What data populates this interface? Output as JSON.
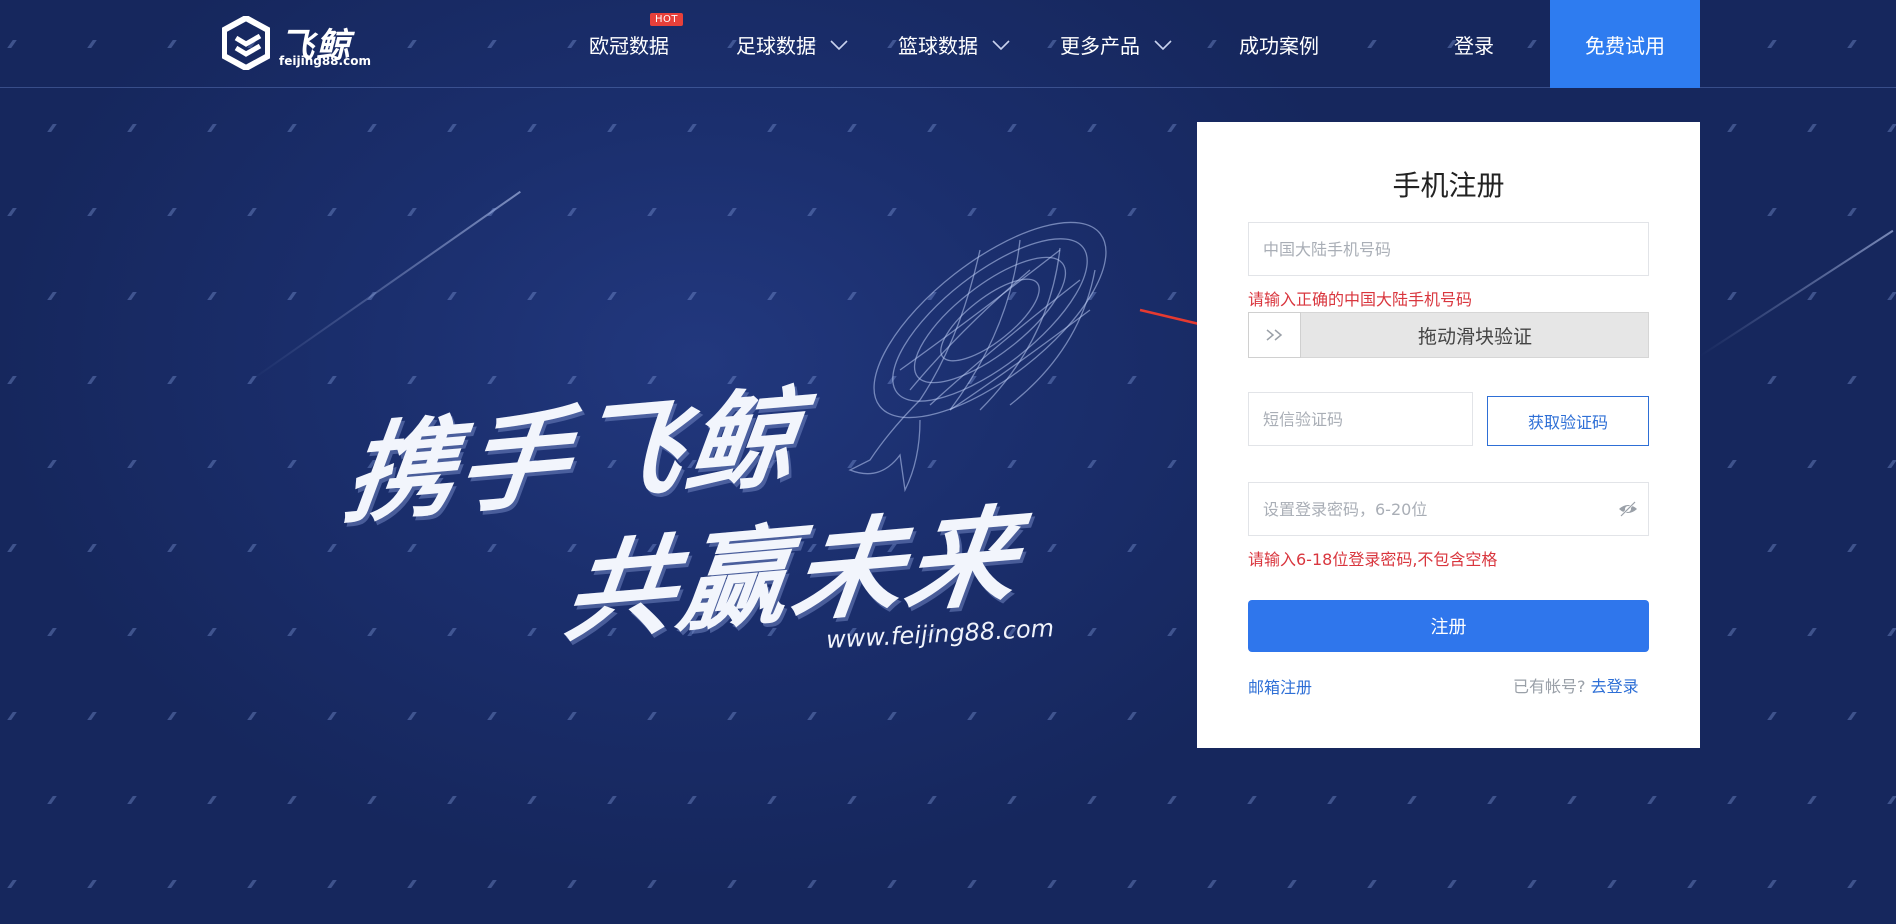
{
  "brand": {
    "name_cn": "飞鲸",
    "domain": "feijing88.com"
  },
  "nav": {
    "items": [
      {
        "label": "欧冠数据",
        "badge": "HOT",
        "dropdown": false
      },
      {
        "label": "足球数据",
        "dropdown": true
      },
      {
        "label": "篮球数据",
        "dropdown": true
      },
      {
        "label": "更多产品",
        "dropdown": true
      },
      {
        "label": "成功案例",
        "dropdown": false
      }
    ],
    "login_label": "登录",
    "trial_label": "免费试用"
  },
  "hero": {
    "slogan_line1": "携手飞鲸",
    "slogan_line2": "共赢未来",
    "url": "www.feijing88.com"
  },
  "register": {
    "title": "手机注册",
    "phone_placeholder": "中国大陆手机号码",
    "phone_error": "请输入正确的中国大陆手机号码",
    "slider_text": "拖动滑块验证",
    "sms_placeholder": "短信验证码",
    "sms_button": "获取验证码",
    "password_placeholder": "设置登录密码，6-20位",
    "password_error": "请输入6-18位登录密码,不包含空格",
    "submit_label": "注册",
    "email_register": "邮箱注册",
    "has_account": "已有帐号?",
    "go_login": "去登录"
  },
  "colors": {
    "background": "#1a2d6b",
    "accent": "#2e7cf0",
    "error": "#d9363e",
    "link": "#2e6fd6"
  }
}
